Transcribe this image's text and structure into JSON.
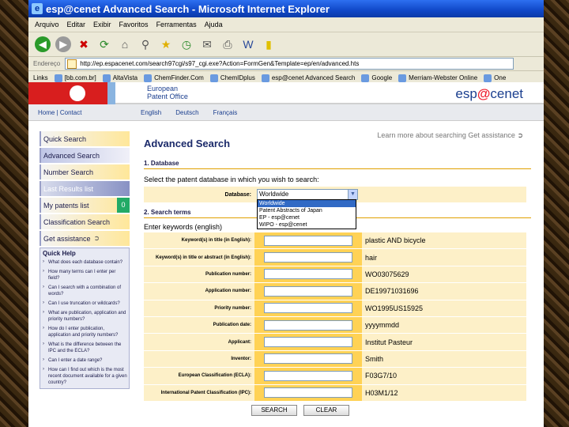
{
  "window": {
    "title": "esp@cenet Advanced Search - Microsoft Internet Explorer"
  },
  "menu": [
    "Arquivo",
    "Editar",
    "Exibir",
    "Favoritos",
    "Ferramentas",
    "Ajuda"
  ],
  "address": {
    "label": "Endereço",
    "url": "http://ep.espacenet.com/search97cgi/s97_cgi.exe?Action=FormGen&Template=ep/en/advanced.hts"
  },
  "links": {
    "label": "Links",
    "items": [
      "[bb.com.br]",
      "AltaVista",
      "ChemFinder.Com",
      "ChemIDplus",
      "esp@cenet Advanced Search",
      "Google",
      "Merriam-Webster Online",
      "One"
    ]
  },
  "banner": {
    "org_line1": "European",
    "org_line2": "Patent Office",
    "brand": "espacenet"
  },
  "nav": {
    "home_contact": "Home | Contact",
    "languages": [
      "English",
      "Deutsch",
      "Français"
    ]
  },
  "sidebar": {
    "items": [
      {
        "label": "Quick Search"
      },
      {
        "label": "Advanced Search"
      },
      {
        "label": "Number Search"
      },
      {
        "label": "Last Results list"
      },
      {
        "label": "My patents list",
        "count": "0"
      },
      {
        "label": "Classification Search"
      },
      {
        "label": "Get assistance"
      }
    ],
    "quick_help": {
      "title": "Quick Help",
      "items": [
        "What does each database contain?",
        "How many terms can I enter per field?",
        "Can I search with a combination of words?",
        "Can I use truncation or wildcards?",
        "What are publication, application and priority numbers?",
        "How do I enter publication, application and priority numbers?",
        "What is the difference between the IPC and the ECLA?",
        "Can I enter a date range?",
        "How can I find out which is the most recent document available for a given country?"
      ]
    }
  },
  "main": {
    "learn_more": "Learn more about searching Get assistance",
    "title": "Advanced Search",
    "section1": "1. Database",
    "db_prompt": "Select the patent database in which you wish to search:",
    "db_label": "Database:",
    "db_selected": "Worldwide",
    "db_options": [
      "Worldwide",
      "Patent Abstracts of Japan",
      "EP - esp@cenet",
      "WIPO - esp@cenet"
    ],
    "section2": "2. Search terms",
    "keywords_label": "Enter keywords (english)",
    "fields": [
      {
        "label": "Keyword(s) in title (in English):",
        "example": "plastic AND bicycle"
      },
      {
        "label": "Keyword(s) in title or abstract (in English):",
        "example": "hair"
      },
      {
        "label": "Publication number:",
        "example": "WO03075629"
      },
      {
        "label": "Application number:",
        "example": "DE19971031696"
      },
      {
        "label": "Priority number:",
        "example": "WO1995US15925"
      },
      {
        "label": "Publication date:",
        "example": "yyyymmdd"
      },
      {
        "label": "Applicant:",
        "example": "Institut Pasteur"
      },
      {
        "label": "Inventor:",
        "example": "Smith"
      },
      {
        "label": "European Classification (ECLA):",
        "example": "F03G7/10"
      },
      {
        "label": "International Patent Classification (IPC):",
        "example": "H03M1/12"
      }
    ],
    "search_button": "SEARCH",
    "clear_button": "CLEAR"
  },
  "colors": {
    "titlebar": "#0b3aa8",
    "epo_red": "#d81e1e",
    "field_gold": "#ffd255",
    "field_pale": "#fdf0c8"
  }
}
